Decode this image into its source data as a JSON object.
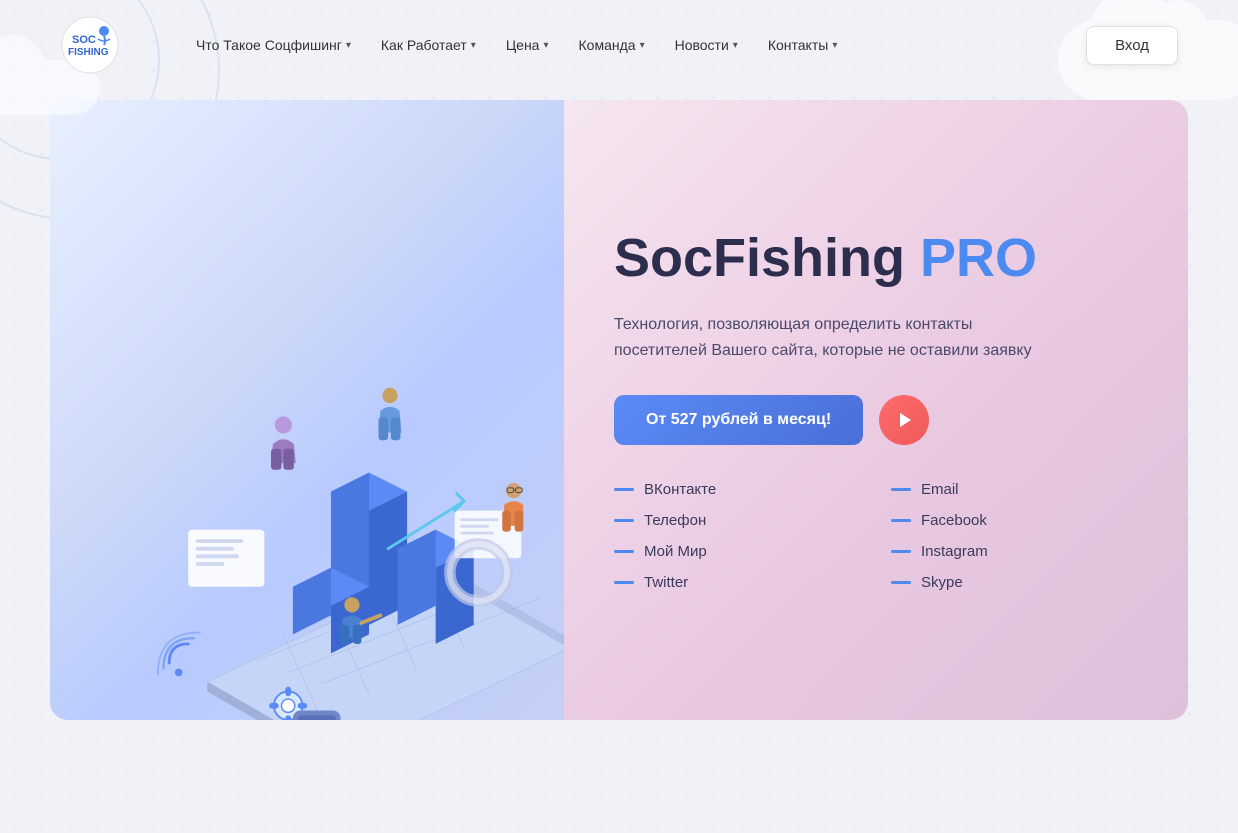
{
  "logo": {
    "alt": "SocFishing Logo",
    "text": "SOC FISHING"
  },
  "nav": {
    "items": [
      {
        "label": "Что Такое Соцфишинг",
        "hasDropdown": true
      },
      {
        "label": "Как Работает",
        "hasDropdown": true
      },
      {
        "label": "Цена",
        "hasDropdown": true
      },
      {
        "label": "Команда",
        "hasDropdown": true
      },
      {
        "label": "Новости",
        "hasDropdown": true
      },
      {
        "label": "Контакты",
        "hasDropdown": true
      }
    ],
    "login_label": "Вход"
  },
  "hero": {
    "title_part1": "SocFishing ",
    "title_part2": "PRO",
    "subtitle": "Технология, позволяющая определить контакты посетителей Вашего сайта, которые не оставили заявку",
    "cta_label": "От 527 рублей в месяц!",
    "cta_price": "527",
    "features_left": [
      "ВКонтакте",
      "Телефон",
      "Мой Мир",
      "Twitter"
    ],
    "features_right": [
      "Email",
      "Facebook",
      "Instagram",
      "Skype"
    ]
  },
  "colors": {
    "accent_blue": "#4d8af0",
    "accent_red": "#ee5a5a",
    "title_dark": "#2d2d4e",
    "text_gray": "#4a4a6a"
  }
}
